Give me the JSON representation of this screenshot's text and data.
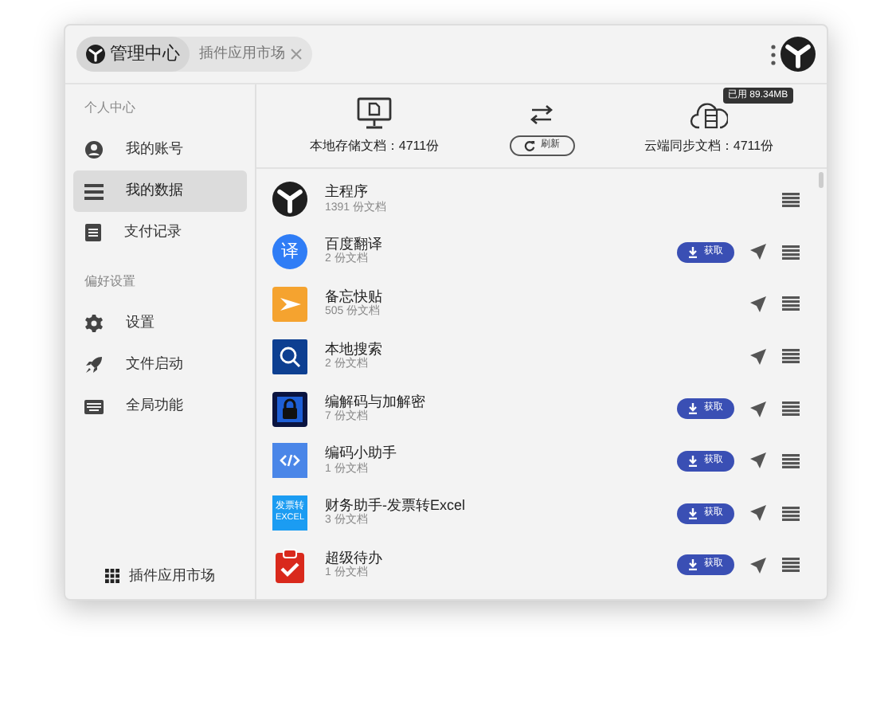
{
  "tabs": [
    {
      "label": "管理中心",
      "selected": true,
      "closable": false
    },
    {
      "label": "插件应用市场",
      "selected": false,
      "closable": true
    }
  ],
  "sidebar": {
    "sections": [
      {
        "title": "个人中心",
        "items": [
          {
            "label": "我的账号",
            "kind": "account",
            "selected": false
          },
          {
            "label": "我的数据",
            "kind": "list",
            "selected": true
          },
          {
            "label": "支付记录",
            "kind": "receipt",
            "selected": false
          }
        ]
      },
      {
        "title": "偏好设置",
        "items": [
          {
            "label": "设置",
            "kind": "gear",
            "selected": false
          },
          {
            "label": "文件启动",
            "kind": "rocket",
            "selected": false
          },
          {
            "label": "全局功能",
            "kind": "keyboard",
            "selected": false
          }
        ]
      }
    ],
    "footer": "插件应用市场"
  },
  "stats": {
    "local": "本地存储文档：4711份",
    "refresh": "刷新",
    "cloud": "云端同步文档：4711份",
    "tooltip": "已用 89.34MB"
  },
  "plugins": [
    {
      "name": "主程序",
      "docs": "1391 份文档",
      "kind": "logo",
      "get": false,
      "send": false
    },
    {
      "name": "百度翻译",
      "docs": "2 份文档",
      "kind": "translate",
      "icon_text": "译",
      "get": true,
      "get_label": "获取",
      "send": true
    },
    {
      "name": "备忘快贴",
      "docs": "505 份文档",
      "kind": "memo",
      "get": false,
      "send": true
    },
    {
      "name": "本地搜索",
      "docs": "2 份文档",
      "kind": "search",
      "get": false,
      "send": true
    },
    {
      "name": "编解码与加解密",
      "docs": "7 份文档",
      "kind": "lock",
      "get": true,
      "get_label": "获取",
      "send": true
    },
    {
      "name": "编码小助手",
      "docs": "1 份文档",
      "kind": "code",
      "get": true,
      "get_label": "获取",
      "send": true
    },
    {
      "name": "财务助手-发票转Excel",
      "docs": "3 份文档",
      "kind": "invoice",
      "icon_text": "发票转",
      "icon_text2": "EXCEL",
      "get": true,
      "get_label": "获取",
      "send": true
    },
    {
      "name": "超级待办",
      "docs": "1 份文档",
      "kind": "todo",
      "get": true,
      "get_label": "获取",
      "send": true
    }
  ]
}
